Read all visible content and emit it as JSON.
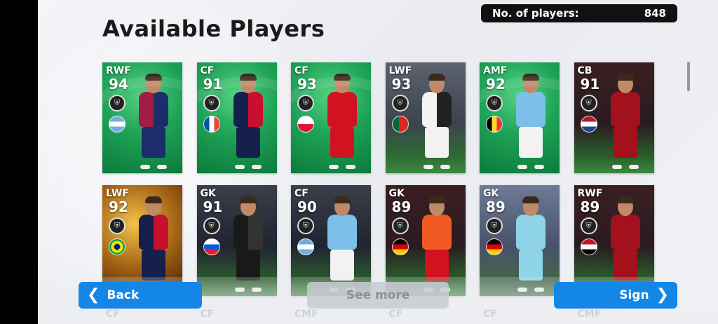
{
  "header": {
    "title": "Available Players",
    "count_label": "No. of players:",
    "count_value": "848"
  },
  "players": [
    {
      "pos": "RWF",
      "rating": "94",
      "bg": "green",
      "flag": "argentina",
      "kit": "#a11d45",
      "kit2": "#1b2d6b",
      "shorts": "#1b2d6b"
    },
    {
      "pos": "CF",
      "rating": "91",
      "bg": "green",
      "flag": "france",
      "kit": "#15204d",
      "kit2": "#c8102e",
      "shorts": "#15204d"
    },
    {
      "pos": "CF",
      "rating": "93",
      "bg": "green",
      "flag": "poland",
      "kit": "#d1121f",
      "kit2": "#d1121f",
      "shorts": "#d1121f"
    },
    {
      "pos": "LWF",
      "rating": "93",
      "bg": "stadium",
      "flag": "portugal",
      "kit": "#f2f2f2",
      "kit2": "#222",
      "shorts": "#f2f2f2"
    },
    {
      "pos": "AMF",
      "rating": "92",
      "bg": "green",
      "flag": "belgium",
      "kit": "#7cc0ea",
      "kit2": "#7cc0ea",
      "shorts": "#f2f2f2"
    },
    {
      "pos": "CB",
      "rating": "91",
      "bg": "crowd",
      "flag": "netherlands",
      "kit": "#a3111d",
      "kit2": "#a3111d",
      "shorts": "#a3111d"
    },
    {
      "pos": "LWF",
      "rating": "92",
      "bg": "gold",
      "flag": "brazil",
      "kit": "#15204d",
      "kit2": "#c8102e",
      "shorts": "#15204d"
    },
    {
      "pos": "GK",
      "rating": "91",
      "bg": "photo",
      "flag": "slovenia",
      "kit": "#1a1a1a",
      "kit2": "#333",
      "shorts": "#1a1a1a"
    },
    {
      "pos": "CF",
      "rating": "90",
      "bg": "photo",
      "flag": "argentina",
      "kit": "#7cc0ea",
      "kit2": "#7cc0ea",
      "shorts": "#f2f2f2"
    },
    {
      "pos": "GK",
      "rating": "89",
      "bg": "crowd",
      "flag": "germany",
      "kit": "#f15a22",
      "kit2": "#f15a22",
      "shorts": "#d1121f"
    },
    {
      "pos": "GK",
      "rating": "89",
      "bg": "blue",
      "flag": "germany",
      "kit": "#8fd3e8",
      "kit2": "#8fd3e8",
      "shorts": "#8fd3e8"
    },
    {
      "pos": "RWF",
      "rating": "89",
      "bg": "crowd",
      "flag": "egypt",
      "kit": "#a3111d",
      "kit2": "#a3111d",
      "shorts": "#a3111d"
    }
  ],
  "ghost_positions": [
    "CF",
    "CF",
    "CMF",
    "CF",
    "CF",
    "CMF"
  ],
  "buttons": {
    "back": "Back",
    "see_more": "See more",
    "sign": "Sign"
  },
  "icons": {
    "back": "chevron-left-icon",
    "sign": "chevron-right-icon",
    "badge": "shield-icon"
  }
}
